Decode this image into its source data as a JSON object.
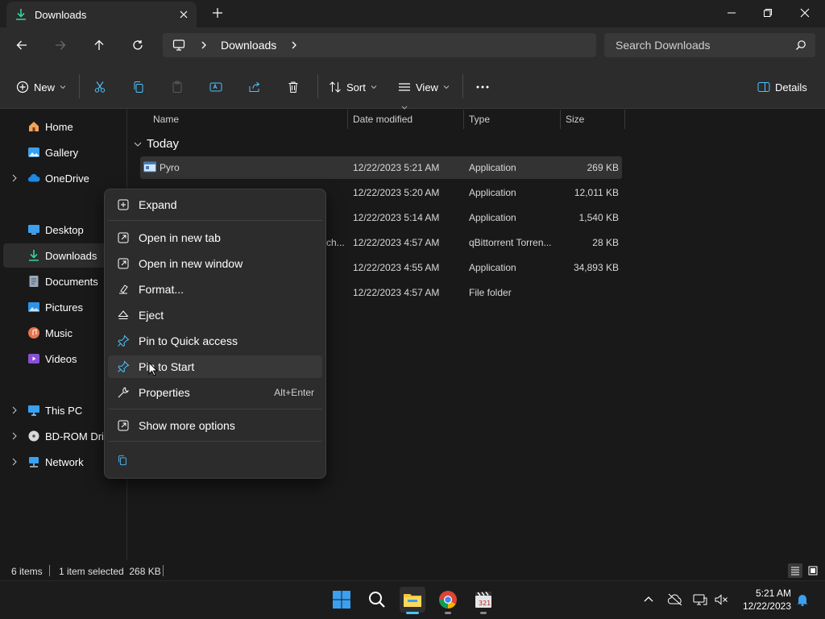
{
  "window": {
    "tab_title": "Downloads"
  },
  "address": {
    "crumbs": [
      "Downloads"
    ],
    "search_placeholder": "Search Downloads"
  },
  "toolbar": {
    "new_label": "New",
    "sort_label": "Sort",
    "view_label": "View",
    "details_label": "Details"
  },
  "sidebar": {
    "items": [
      {
        "label": "Home",
        "icon": "home-icon"
      },
      {
        "label": "Gallery",
        "icon": "gallery-icon"
      },
      {
        "label": "OneDrive",
        "icon": "cloud-icon"
      },
      {
        "label": "Desktop",
        "icon": "desktop-icon"
      },
      {
        "label": "Downloads",
        "icon": "download-icon"
      },
      {
        "label": "Documents",
        "icon": "document-icon"
      },
      {
        "label": "Pictures",
        "icon": "picture-icon"
      },
      {
        "label": "Music",
        "icon": "music-icon"
      },
      {
        "label": "Videos",
        "icon": "video-icon"
      },
      {
        "label": "This PC",
        "icon": "pc-icon"
      },
      {
        "label": "BD-ROM Drive",
        "icon": "disc-icon"
      },
      {
        "label": "Network",
        "icon": "network-icon"
      }
    ]
  },
  "filelist": {
    "columns": [
      "Name",
      "Date modified",
      "Type",
      "Size"
    ],
    "group": "Today",
    "rows": [
      {
        "name": "Pyro",
        "date": "12/22/2023 5:21 AM",
        "type": "Application",
        "size": "269 KB"
      },
      {
        "name": "",
        "date": "12/22/2023 5:20 AM",
        "type": "Application",
        "size": "12,011 KB"
      },
      {
        "name": "",
        "date": "12/22/2023 5:14 AM",
        "type": "Application",
        "size": "1,540 KB"
      },
      {
        "name": "ch...",
        "date": "12/22/2023 4:57 AM",
        "type": "qBittorrent Torren...",
        "size": "28 KB"
      },
      {
        "name": "",
        "date": "12/22/2023 4:55 AM",
        "type": "Application",
        "size": "34,893 KB"
      },
      {
        "name": "",
        "date": "12/22/2023 4:57 AM",
        "type": "File folder",
        "size": ""
      }
    ]
  },
  "context_menu": {
    "items": [
      {
        "label": "Expand",
        "icon": "expand-icon"
      },
      {
        "label": "Open in new tab",
        "icon": "new-tab-icon"
      },
      {
        "label": "Open in new window",
        "icon": "new-window-icon"
      },
      {
        "label": "Format...",
        "icon": "format-icon"
      },
      {
        "label": "Eject",
        "icon": "eject-icon"
      },
      {
        "label": "Pin to Quick access",
        "icon": "pin-icon"
      },
      {
        "label": "Pin to Start",
        "icon": "pin-icon"
      },
      {
        "label": "Properties",
        "icon": "wrench-icon",
        "accelerator": "Alt+Enter"
      },
      {
        "label": "Show more options",
        "icon": "more-options-icon"
      }
    ]
  },
  "status": {
    "item_count": "6 items",
    "selection": "1 item selected  268 KB"
  },
  "taskbar": {
    "time": "5:21 AM",
    "date": "12/22/2023"
  },
  "colors": {
    "accent": "#4cc2ff",
    "background": "#191919",
    "menu": "#2c2c2c"
  }
}
